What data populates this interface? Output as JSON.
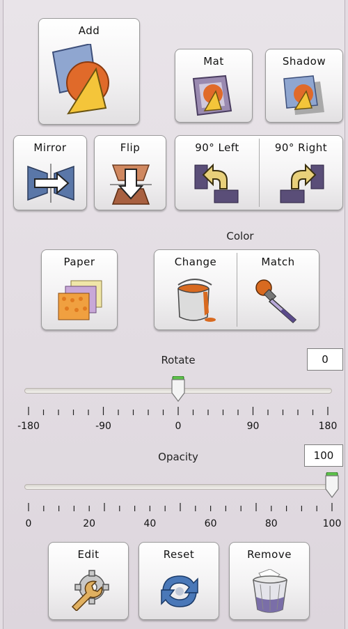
{
  "buttons": {
    "add": {
      "label": "Add"
    },
    "mat": {
      "label": "Mat"
    },
    "shadow": {
      "label": "Shadow"
    },
    "mirror": {
      "label": "Mirror"
    },
    "flip": {
      "label": "Flip"
    },
    "rotate_left": {
      "label": "90° Left"
    },
    "rotate_right": {
      "label": "90° Right"
    },
    "paper": {
      "label": "Paper"
    },
    "color_change": {
      "label": "Change"
    },
    "color_match": {
      "label": "Match"
    },
    "edit": {
      "label": "Edit"
    },
    "reset": {
      "label": "Reset"
    },
    "remove": {
      "label": "Remove"
    }
  },
  "color_group": {
    "title": "Color"
  },
  "rotate": {
    "label": "Rotate",
    "value": "0",
    "min": -180,
    "max": 180,
    "tick_labels": [
      "-180",
      "-90",
      "0",
      "90",
      "180"
    ]
  },
  "opacity": {
    "label": "Opacity",
    "value": "100",
    "min": 0,
    "max": 100,
    "tick_labels": [
      "0",
      "20",
      "40",
      "60",
      "80",
      "100"
    ]
  },
  "colors": {
    "accent_green": "#5cc24a",
    "orange": "#e0702a",
    "yellow": "#f0c030",
    "purple": "#6a5a8a"
  }
}
